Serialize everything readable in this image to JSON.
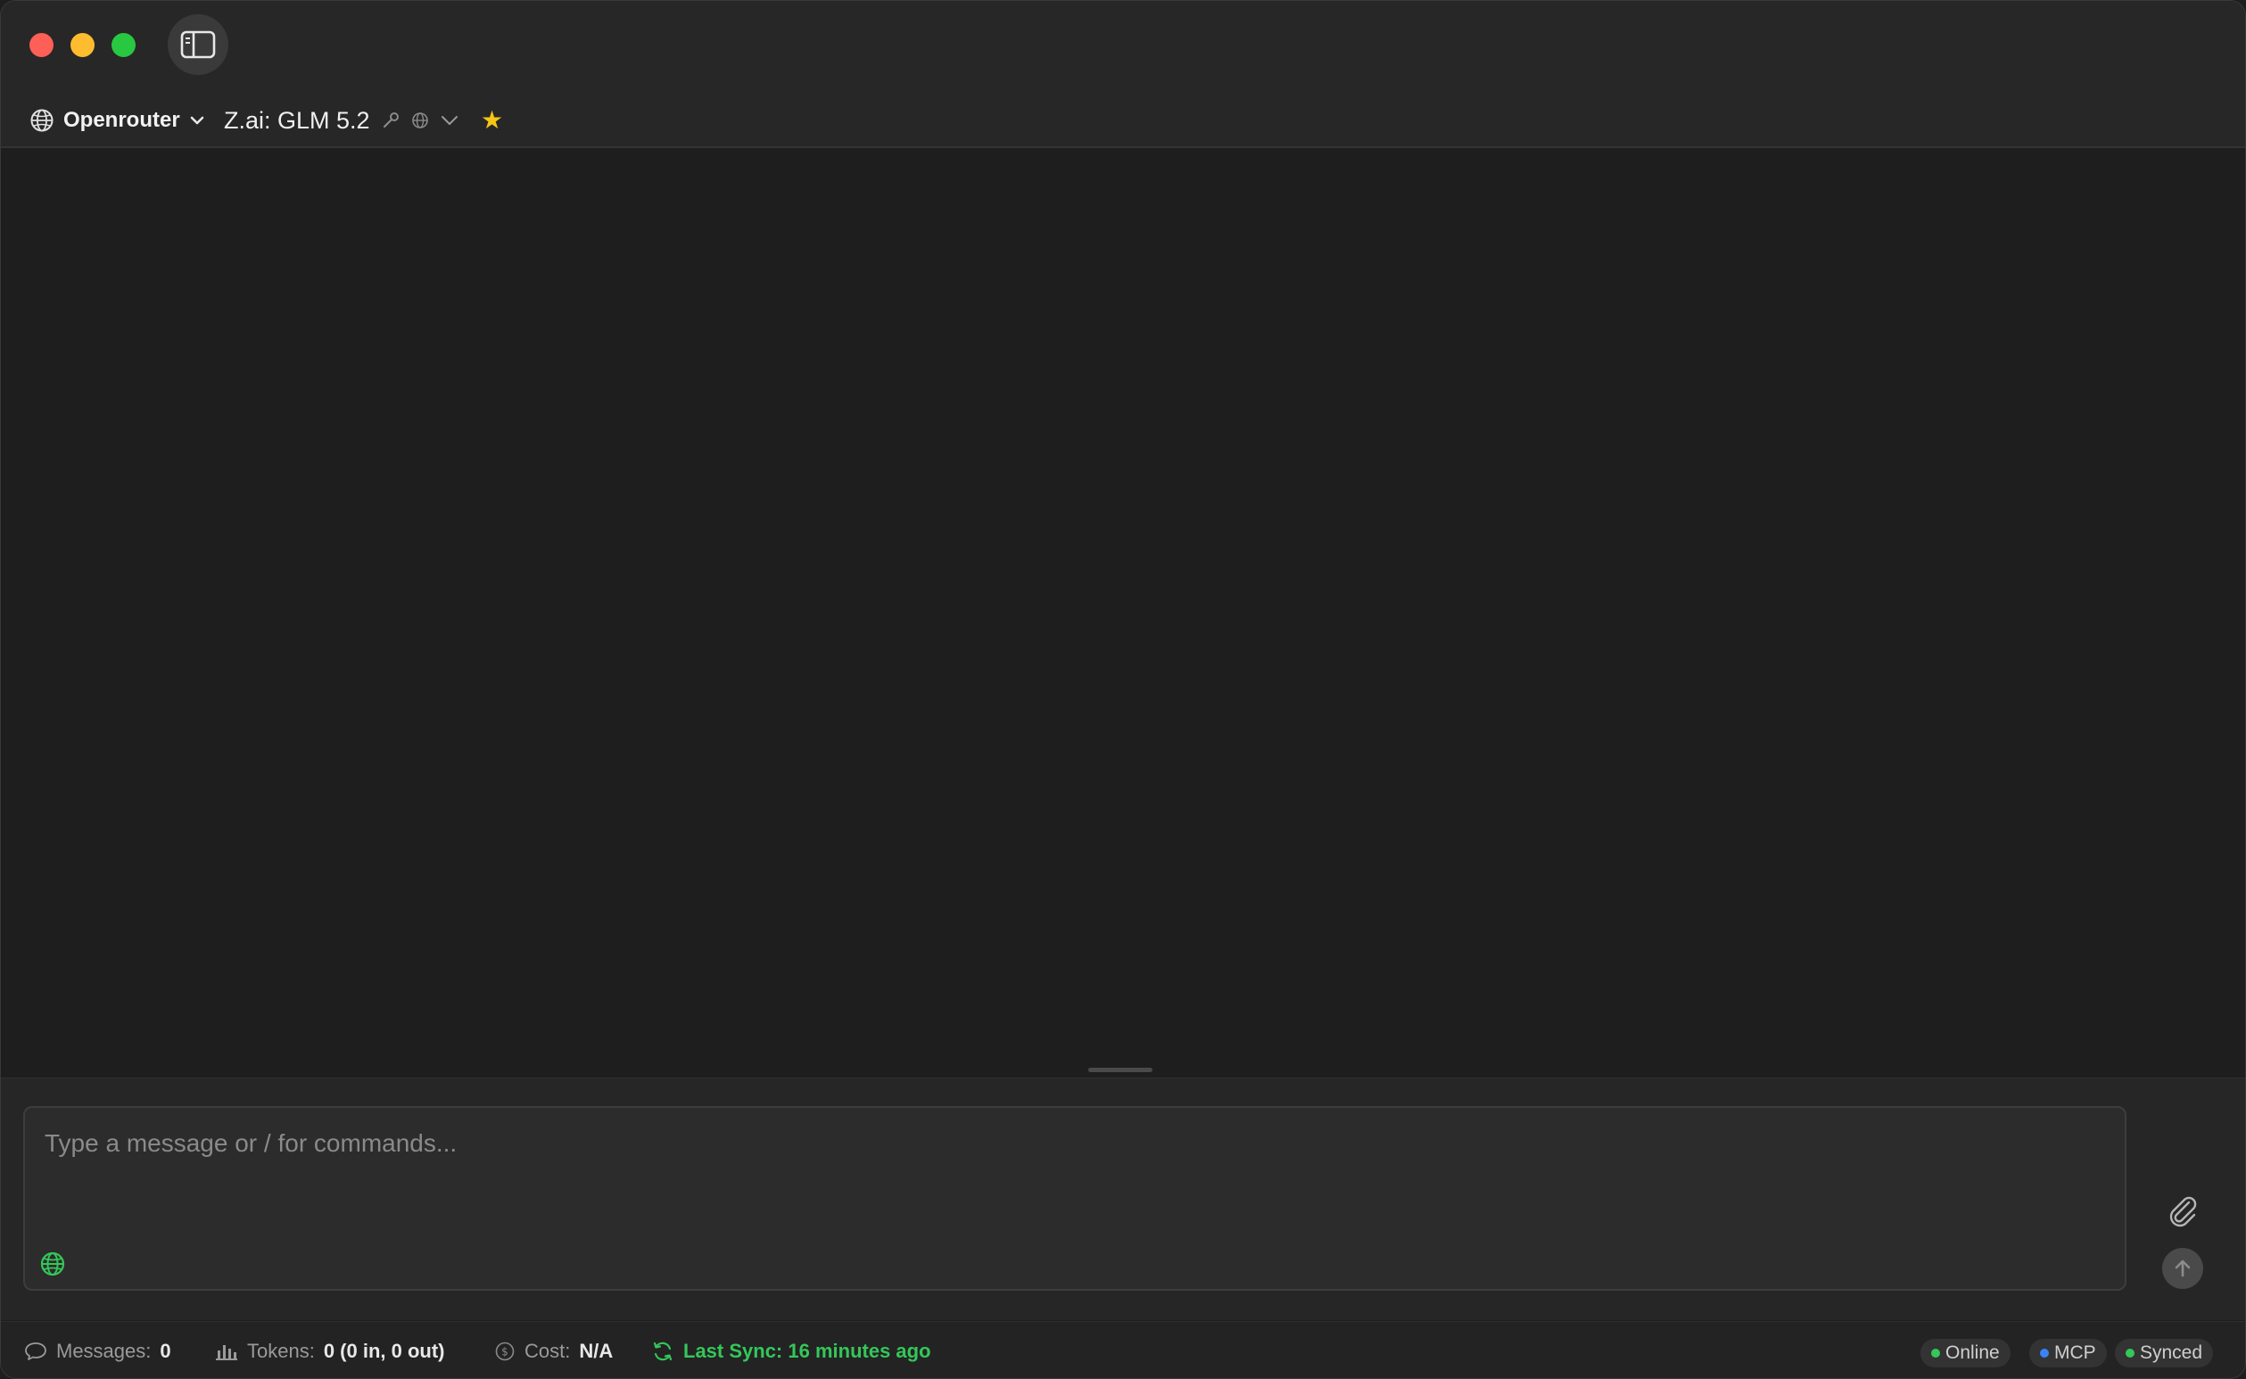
{
  "header": {
    "provider_label": "Openrouter",
    "model_label": "Z.ai: GLM 5.2",
    "icons": {
      "sidebar": "sidebar-toggle-icon",
      "provider": "globe-icon",
      "provider_chevron": "chevron-down-icon",
      "model_tools": "wrench-icon",
      "model_web": "globe-icon",
      "model_chevron": "chevron-down-icon",
      "favorite": "star-icon"
    }
  },
  "composer": {
    "placeholder": "Type a message or / for commands...",
    "value": ""
  },
  "statusbar": {
    "messages_label": "Messages:",
    "messages_value": "0",
    "tokens_label": "Tokens:",
    "tokens_value": "0 (0 in, 0 out)",
    "cost_label": "Cost:",
    "cost_value": "N/A",
    "sync_text": "Last Sync: 16 minutes ago",
    "badges": [
      {
        "label": "Online",
        "color": "#34c759"
      },
      {
        "label": "MCP",
        "color": "#3b82f6"
      },
      {
        "label": "Synced",
        "color": "#34c759"
      }
    ]
  },
  "colors": {
    "accent_green": "#34c759",
    "star_yellow": "#f5c518",
    "window_bg": "#1e1e1e"
  }
}
